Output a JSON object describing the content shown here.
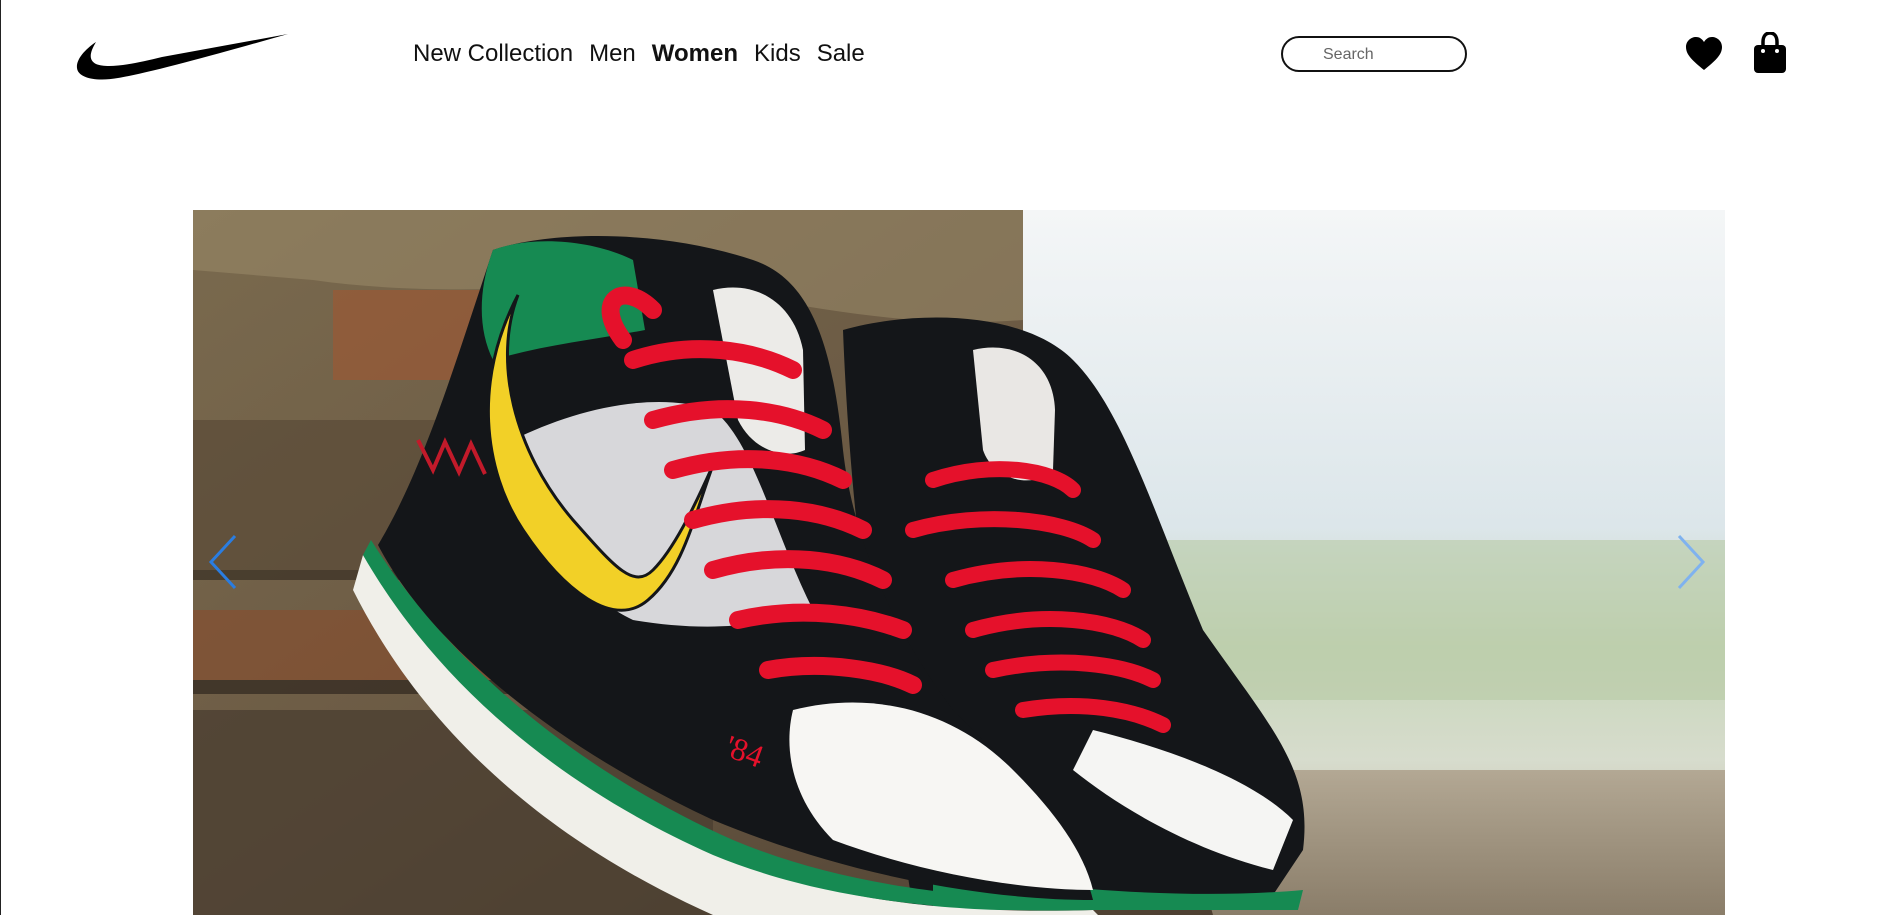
{
  "brand": {
    "logo_icon": "swoosh-logo-icon"
  },
  "nav": {
    "items": [
      {
        "label": "New Collection",
        "active": false
      },
      {
        "label": "Men",
        "active": false
      },
      {
        "label": "Women",
        "active": true
      },
      {
        "label": "Kids",
        "active": false
      },
      {
        "label": "Sale",
        "active": false
      }
    ]
  },
  "search": {
    "placeholder": "Search",
    "value": ""
  },
  "actions": {
    "favorites_icon": "heart-icon",
    "bag_icon": "shopping-bag-icon"
  },
  "carousel": {
    "prev_icon": "chevron-left-icon",
    "next_icon": "chevron-right-icon",
    "slide_image": "sneaker-photo",
    "shoe_print": "'84"
  },
  "colors": {
    "arrow": "#2a7de1",
    "lace": "#e5112b",
    "swoosh": "#f2d027",
    "collar": "#12843e",
    "suede": "#141619"
  }
}
